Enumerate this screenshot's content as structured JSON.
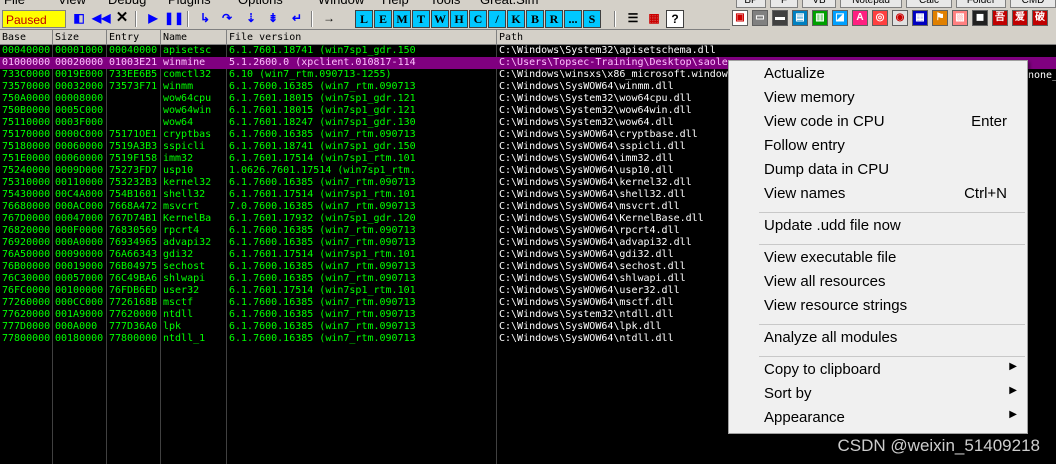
{
  "menubar": [
    "File",
    "View",
    "Debug",
    "Plugins",
    "Options",
    "Window",
    "Help",
    "Tools",
    "Great.Sim"
  ],
  "toolbar": {
    "status": "Paused",
    "letters": [
      "L",
      "E",
      "M",
      "T",
      "W",
      "H",
      "C",
      "/",
      "K",
      "B",
      "R",
      "...",
      "S"
    ]
  },
  "right_tabs": [
    "BP",
    "F",
    "VB",
    "Notepad",
    "Calc",
    "Folder",
    "CMD"
  ],
  "columns": [
    "Base",
    "Size",
    "Entry",
    "Name",
    "File version",
    "Path"
  ],
  "rows": [
    {
      "base": "00040000",
      "size": "00001000",
      "entry": "00040000",
      "name": "apisetsc",
      "version": "6.1.7601.18741 (win7sp1_gdr.150",
      "path": "C:\\Windows\\System32\\apisetschema.dll",
      "selected": false
    },
    {
      "base": "01000000",
      "size": "00020000",
      "entry": "01003E21",
      "name": "winmine",
      "version": "5.1.2600.0 (xpclient.010817-114",
      "path": "C:\\Users\\Topsec-Training\\Desktop\\saole",
      "selected": true
    },
    {
      "base": "733C0000",
      "size": "0019E000",
      "entry": "733EE6B5",
      "name": "comctl32",
      "version": "6.10 (win7_rtm.090713-1255)",
      "path": "C:\\Windows\\winsxs\\x86_microsoft.window",
      "selected": false
    },
    {
      "base": "73570000",
      "size": "00032000",
      "entry": "73573F71",
      "name": "winmm",
      "version": "6.1.7600.16385 (win7_rtm.090713",
      "path": "C:\\Windows\\SysWOW64\\winmm.dll",
      "selected": false
    },
    {
      "base": "750A0000",
      "size": "00008000",
      "entry": "",
      "name": "wow64cpu",
      "version": "6.1.7601.18015 (win7sp1_gdr.121",
      "path": "C:\\Windows\\System32\\wow64cpu.dll",
      "selected": false
    },
    {
      "base": "750B0000",
      "size": "0005C000",
      "entry": "",
      "name": "wow64win",
      "version": "6.1.7601.18015 (win7sp1_gdr.121",
      "path": "C:\\Windows\\System32\\wow64win.dll",
      "selected": false
    },
    {
      "base": "75110000",
      "size": "0003F000",
      "entry": "",
      "name": "wow64",
      "version": "6.1.7601.18247 (win7sp1_gdr.130",
      "path": "C:\\Windows\\System32\\wow64.dll",
      "selected": false
    },
    {
      "base": "75170000",
      "size": "0000C000",
      "entry": "75171OE1",
      "name": "cryptbas",
      "version": "6.1.7600.16385 (win7_rtm.090713",
      "path": "C:\\Windows\\SysWOW64\\cryptbase.dll",
      "selected": false
    },
    {
      "base": "75180000",
      "size": "00060000",
      "entry": "7519A3B3",
      "name": "sspicli",
      "version": "6.1.7601.18741 (win7sp1_gdr.150",
      "path": "C:\\Windows\\SysWOW64\\sspicli.dll",
      "selected": false
    },
    {
      "base": "751E0000",
      "size": "00060000",
      "entry": "7519F158",
      "name": "imm32",
      "version": "6.1.7601.17514 (win7sp1_rtm.101",
      "path": "C:\\Windows\\SysWOW64\\imm32.dll",
      "selected": false
    },
    {
      "base": "75240000",
      "size": "0009D000",
      "entry": "75273FD7",
      "name": "usp10",
      "version": "1.0626.7601.17514 (win7sp1_rtm.",
      "path": "C:\\Windows\\SysWOW64\\usp10.dll",
      "selected": false
    },
    {
      "base": "75310000",
      "size": "00110000",
      "entry": "753232B3",
      "name": "kernel32",
      "version": "6.1.7600.16385 (win7_rtm.090713",
      "path": "C:\\Windows\\SysWOW64\\kernel32.dll",
      "selected": false
    },
    {
      "base": "75430000",
      "size": "00C4A000",
      "entry": "754B1601",
      "name": "shell32",
      "version": "6.1.7601.17514 (win7sp1_rtm.101",
      "path": "C:\\Windows\\SysWOW64\\shell32.dll",
      "selected": false
    },
    {
      "base": "76680000",
      "size": "000AC000",
      "entry": "7668A472",
      "name": "msvcrt",
      "version": "7.0.7600.16385 (win7_rtm.090713",
      "path": "C:\\Windows\\SysWOW64\\msvcrt.dll",
      "selected": false
    },
    {
      "base": "767D0000",
      "size": "00047000",
      "entry": "767D74B1",
      "name": "KernelBa",
      "version": "6.1.7601.17932 (win7sp1_gdr.120",
      "path": "C:\\Windows\\SysWOW64\\KernelBase.dll",
      "selected": false
    },
    {
      "base": "76820000",
      "size": "000F0000",
      "entry": "76830569",
      "name": "rpcrt4",
      "version": "6.1.7600.16385 (win7_rtm.090713",
      "path": "C:\\Windows\\SysWOW64\\rpcrt4.dll",
      "selected": false
    },
    {
      "base": "76920000",
      "size": "000A0000",
      "entry": "76934965",
      "name": "advapi32",
      "version": "6.1.7600.16385 (win7_rtm.090713",
      "path": "C:\\Windows\\SysWOW64\\advapi32.dll",
      "selected": false
    },
    {
      "base": "76A50000",
      "size": "00090000",
      "entry": "76A66343",
      "name": "gdi32",
      "version": "6.1.7601.17514 (win7sp1_rtm.101",
      "path": "C:\\Windows\\SysWOW64\\gdi32.dll",
      "selected": false
    },
    {
      "base": "76B00000",
      "size": "00019000",
      "entry": "76B04975",
      "name": "sechost",
      "version": "6.1.7600.16385 (win7_rtm.090713",
      "path": "C:\\Windows\\SysWOW64\\sechost.dll",
      "selected": false
    },
    {
      "base": "76C30000",
      "size": "00057000",
      "entry": "76C49BA6",
      "name": "shlwapi",
      "version": "6.1.7600.16385 (win7_rtm.090713",
      "path": "C:\\Windows\\SysWOW64\\shlwapi.dll",
      "selected": false
    },
    {
      "base": "76FC0000",
      "size": "00100000",
      "entry": "76FDB6ED",
      "name": "user32",
      "version": "6.1.7601.17514 (win7sp1_rtm.101",
      "path": "C:\\Windows\\SysWOW64\\user32.dll",
      "selected": false
    },
    {
      "base": "77260000",
      "size": "000CC000",
      "entry": "7726168B",
      "name": "msctf",
      "version": "6.1.7600.16385 (win7_rtm.090713",
      "path": "C:\\Windows\\SysWOW64\\msctf.dll",
      "selected": false
    },
    {
      "base": "77620000",
      "size": "001A9000",
      "entry": "77620000",
      "name": "ntdll",
      "version": "6.1.7600.16385 (win7_rtm.090713",
      "path": "C:\\Windows\\System32\\ntdll.dll",
      "selected": false
    },
    {
      "base": "777D0000",
      "size": "000A000",
      "entry": "777D36A0",
      "name": "lpk",
      "version": "6.1.7600.16385 (win7_rtm.090713",
      "path": "C:\\Windows\\SysWOW64\\lpk.dll",
      "selected": false
    },
    {
      "base": "77800000",
      "size": "00180000",
      "entry": "77800000",
      "name": "ntdll_1",
      "version": "6.1.7600.16385 (win7_rtm.090713",
      "path": "C:\\Windows\\SysWOW64\\ntdll.dll",
      "selected": false
    }
  ],
  "overflow_path_fragment": "none_",
  "context_menu": [
    {
      "label": "Actualize",
      "shortcut": "",
      "submenu": false
    },
    {
      "label": "View memory",
      "shortcut": "",
      "submenu": false
    },
    {
      "label": "View code in CPU",
      "shortcut": "Enter",
      "submenu": false
    },
    {
      "label": "Follow entry",
      "shortcut": "",
      "submenu": false
    },
    {
      "label": "Dump data in CPU",
      "shortcut": "",
      "submenu": false
    },
    {
      "label": "View names",
      "shortcut": "Ctrl+N",
      "submenu": false
    },
    {
      "sep": true
    },
    {
      "label": "Update .udd file now",
      "shortcut": "",
      "submenu": false
    },
    {
      "sep": true
    },
    {
      "label": "View executable file",
      "shortcut": "",
      "submenu": false
    },
    {
      "label": "View all resources",
      "shortcut": "",
      "submenu": false
    },
    {
      "label": "View resource strings",
      "shortcut": "",
      "submenu": false
    },
    {
      "sep": true
    },
    {
      "label": "Analyze all modules",
      "shortcut": "",
      "submenu": false
    },
    {
      "sep": true
    },
    {
      "label": "Copy to clipboard",
      "shortcut": "",
      "submenu": true
    },
    {
      "label": "Sort by",
      "shortcut": "",
      "submenu": true
    },
    {
      "label": "Appearance",
      "shortcut": "",
      "submenu": true
    }
  ],
  "watermark": "CSDN @weixin_51409218",
  "colors": {
    "status_bg": "#ffff00",
    "status_text": "#c00000",
    "selected_row": "#800080",
    "text_green": "#00ff00",
    "letter_btn": "#00c8ff"
  }
}
